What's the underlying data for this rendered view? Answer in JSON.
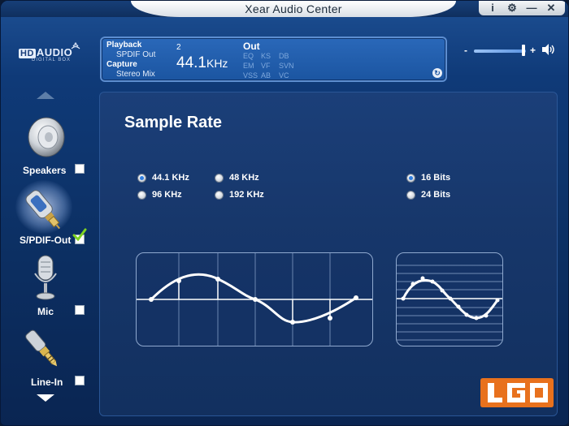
{
  "window": {
    "title": "Xear Audio Center",
    "controls": [
      {
        "icon": "info-icon",
        "glyph": "i"
      },
      {
        "icon": "gear-icon",
        "glyph": "⚙"
      },
      {
        "icon": "minimize-icon",
        "glyph": "—"
      },
      {
        "icon": "close-icon",
        "glyph": "✕"
      }
    ]
  },
  "logo": {
    "brand_hd": "HD",
    "brand_main": "AUDIO",
    "subtitle": "DIGITAL BOX"
  },
  "info_panel": {
    "playback_label": "Playback",
    "playback_value": "SPDIF Out",
    "capture_label": "Capture",
    "capture_value": "Stereo Mix",
    "channels": "2",
    "rate_value": "44.1",
    "rate_unit": "KHz",
    "out_label": "Out",
    "effects": [
      "EQ",
      "KS",
      "DB",
      "EM",
      "VF",
      "SVN",
      "VSS",
      "AB",
      "VC"
    ]
  },
  "volume": {
    "minus": "-",
    "plus": "+",
    "level": 0.93
  },
  "sidebar": {
    "devices": [
      {
        "label": "Speakers",
        "checked": false
      },
      {
        "label": "S/PDIF-Out",
        "checked": true,
        "selected": true
      },
      {
        "label": "Mic",
        "checked": false
      },
      {
        "label": "Line-In",
        "checked": false
      }
    ]
  },
  "content": {
    "title": "Sample Rate",
    "rates": [
      {
        "label": "44.1 KHz",
        "selected": true
      },
      {
        "label": "48 KHz",
        "selected": false
      },
      {
        "label": "96 KHz",
        "selected": false
      },
      {
        "label": "192 KHz",
        "selected": false
      }
    ],
    "bits": [
      {
        "label": "16 Bits",
        "selected": true
      },
      {
        "label": "24 Bits",
        "selected": false
      }
    ]
  },
  "colors": {
    "accent": "#2f7ee0",
    "panel": "#1b55a1",
    "badge": "#e8711d"
  }
}
